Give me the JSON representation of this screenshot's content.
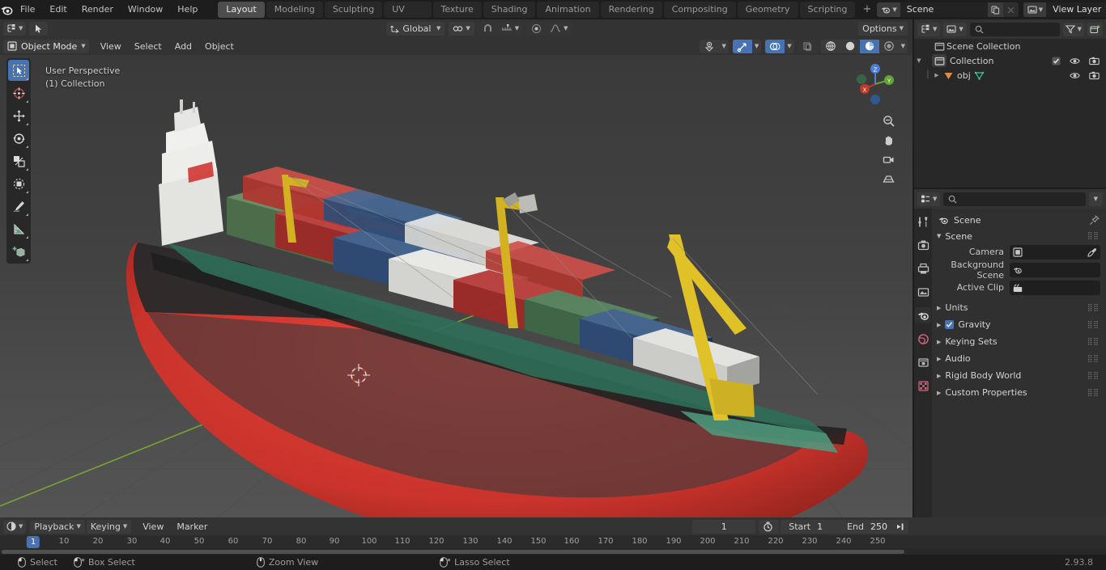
{
  "app": {
    "name": "Blender",
    "version": "2.93.8"
  },
  "topbar": {
    "menus": [
      "File",
      "Edit",
      "Render",
      "Window",
      "Help"
    ],
    "workspaces": [
      {
        "label": "Layout",
        "active": true
      },
      {
        "label": "Modeling",
        "active": false
      },
      {
        "label": "Sculpting",
        "active": false
      },
      {
        "label": "UV Editing",
        "active": false
      },
      {
        "label": "Texture Paint",
        "active": false
      },
      {
        "label": "Shading",
        "active": false
      },
      {
        "label": "Animation",
        "active": false
      },
      {
        "label": "Rendering",
        "active": false
      },
      {
        "label": "Compositing",
        "active": false
      },
      {
        "label": "Geometry Nodes",
        "active": false
      },
      {
        "label": "Scripting",
        "active": false
      }
    ],
    "add_workspace_label": "+",
    "scene": {
      "icon": "scene-icon",
      "name": "Scene",
      "new_icon": "copy-icon",
      "unlink_icon": "x-icon"
    },
    "view_layer": {
      "icon": "view-layer-icon",
      "name": "View Layer",
      "new_icon": "copy-icon",
      "unlink_icon": "x-icon"
    }
  },
  "viewport_header": {
    "mode": "Object Mode",
    "menus": [
      "View",
      "Select",
      "Add",
      "Object"
    ],
    "transform_orientation": "Global",
    "options_label": "Options",
    "snap_icon": "magnet-icon",
    "proportional_icon": "proportional-edit-icon",
    "visibility_icon": "visibility-icon",
    "gizmo_icon": "gizmo-icon",
    "overlays_icon": "overlays-icon",
    "xray_icon": "xray-icon",
    "shading_modes": [
      {
        "name": "wireframe-shading",
        "active": false
      },
      {
        "name": "solid-shading",
        "active": false
      },
      {
        "name": "material-preview-shading",
        "active": true
      },
      {
        "name": "rendered-shading",
        "active": false
      }
    ]
  },
  "viewport": {
    "perspective_label": "User Perspective",
    "collection_label": "(1) Collection",
    "gizmo_axes": [
      "X",
      "Y",
      "Z"
    ],
    "tools": [
      {
        "name": "tweak-select-tool",
        "active": true
      },
      {
        "name": "cursor-tool",
        "active": false
      },
      {
        "name": "move-tool",
        "active": false
      },
      {
        "name": "rotate-tool",
        "active": false
      },
      {
        "name": "scale-tool",
        "active": false
      },
      {
        "name": "transform-tool",
        "active": false
      },
      {
        "name": "annotate-tool",
        "active": false
      },
      {
        "name": "measure-tool",
        "active": false
      },
      {
        "name": "add-cube-tool",
        "active": false
      }
    ],
    "nav_buttons": [
      "zoom-icon",
      "pan-hand-icon",
      "camera-view-icon",
      "toggle-perspective-icon"
    ],
    "object": "container ship 3D model"
  },
  "outliner": {
    "display_mode_icon": "outliner-icon",
    "filter_icon": "filter-icon",
    "new_collection_icon": "new-collection-icon",
    "search_placeholder": "",
    "rows": [
      {
        "label": "Scene Collection",
        "icon": "scene-collection-icon",
        "indent": 0,
        "expandable": false,
        "selected": false,
        "checkbox": false,
        "eye": false,
        "camera": false
      },
      {
        "label": "Collection",
        "icon": "collection-icon",
        "indent": 1,
        "expandable": true,
        "selected": false,
        "checkbox": true,
        "eye": true,
        "camera": true
      },
      {
        "label": "obj",
        "icon": "mesh-object-icon",
        "indent": 2,
        "expandable": true,
        "selected": false,
        "checkbox": false,
        "eye": true,
        "camera": true,
        "data_icon": "mesh-data-icon"
      }
    ]
  },
  "properties": {
    "editor_icon": "properties-icon",
    "search_placeholder": "",
    "tabs": [
      {
        "name": "tool-tab",
        "active": false
      },
      {
        "name": "render-tab",
        "active": false
      },
      {
        "name": "output-tab",
        "active": false
      },
      {
        "name": "view-layer-tab",
        "active": false
      },
      {
        "name": "scene-tab",
        "active": true
      },
      {
        "name": "world-tab",
        "active": false
      },
      {
        "name": "object-tab",
        "active": false
      },
      {
        "name": "texture-tab",
        "active": false
      }
    ],
    "breadcrumb": "Scene",
    "pin_icon": "pin-icon",
    "panel_title": "Scene",
    "fields": [
      {
        "label": "Camera",
        "value": "",
        "icon": "camera-data-icon",
        "action_icon": "eyedropper-icon"
      },
      {
        "label": "Background Scene",
        "value": "",
        "icon": "scene-icon",
        "action_icon": ""
      },
      {
        "label": "Active Clip",
        "value": "",
        "icon": "clip-icon",
        "action_icon": ""
      }
    ],
    "sections": [
      {
        "label": "Units",
        "checkbox": false
      },
      {
        "label": "Gravity",
        "checkbox": true,
        "checked": true
      },
      {
        "label": "Keying Sets",
        "checkbox": false
      },
      {
        "label": "Audio",
        "checkbox": false
      },
      {
        "label": "Rigid Body World",
        "checkbox": false
      },
      {
        "label": "Custom Properties",
        "checkbox": false
      }
    ]
  },
  "timeline": {
    "editor_icon": "timeline-icon",
    "menus": [
      "Playback",
      "Keying",
      "View",
      "Marker"
    ],
    "record_icon": "record-icon",
    "transport": [
      "jump-to-start-icon",
      "jump-to-prev-keyframe-icon",
      "play-reverse-icon",
      "play-icon",
      "jump-to-next-keyframe-icon",
      "jump-to-end-icon"
    ],
    "current_frame": "1",
    "auto_key_icon": "auto-keying-icon",
    "start_label": "Start",
    "start_value": "1",
    "end_label": "End",
    "end_value": "250",
    "playhead_frame": "1",
    "ruler_ticks": [
      "10",
      "20",
      "30",
      "40",
      "50",
      "60",
      "70",
      "80",
      "90",
      "100",
      "110",
      "120",
      "130",
      "140",
      "150",
      "160",
      "170",
      "180",
      "190",
      "200",
      "210",
      "220",
      "230",
      "240",
      "250"
    ]
  },
  "statusbar": {
    "items": [
      {
        "icon": "mouse-left-icon",
        "label": "Select"
      },
      {
        "icon": "mouse-left-drag-icon",
        "label": "Box Select"
      },
      {
        "icon": "mouse-middle-icon",
        "label": "Zoom View"
      },
      {
        "icon": "mouse-left-drag-icon",
        "label": "Lasso Select"
      }
    ],
    "version": "2.93.8"
  },
  "colors": {
    "accent": "#4772b3",
    "header": "#333333",
    "panel": "#303030",
    "dark": "#1d1d1d",
    "outliner": "#282828"
  }
}
